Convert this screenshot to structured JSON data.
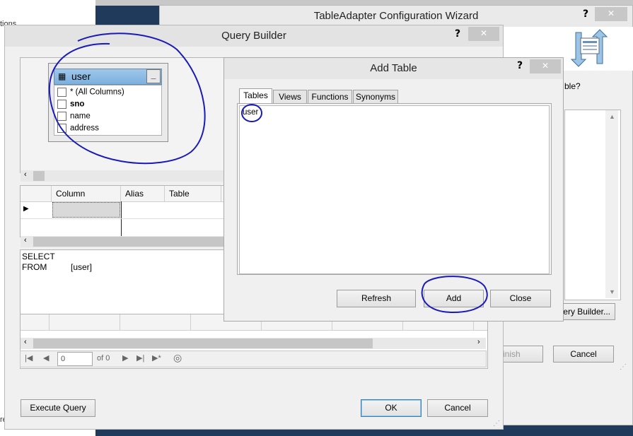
{
  "background": {
    "left_top_text": "tions",
    "left_bottom_text": "re"
  },
  "wizard": {
    "title": "TableAdapter Configuration Wizard",
    "help_glyph": "?",
    "close_glyph": "✕",
    "question_partial": "ble?",
    "query_builder_button": "ery Builder...",
    "finish_button": "inish",
    "cancel_button": "Cancel"
  },
  "query_builder": {
    "title": "Query Builder",
    "help_glyph": "?",
    "close_glyph": "✕",
    "table_box": {
      "title": "user",
      "minimize_glyph": "_",
      "columns": [
        {
          "label": "* (All Columns)",
          "bold": false
        },
        {
          "label": "sno",
          "bold": true
        },
        {
          "label": "name",
          "bold": false
        },
        {
          "label": "address",
          "bold": false
        }
      ]
    },
    "grid_headers": [
      "Column",
      "Alias",
      "Table"
    ],
    "row_arrow": "▶",
    "sql": {
      "line1": "SELECT",
      "line2_keyword": "FROM",
      "line2_value": "[user]"
    },
    "navigator": {
      "position_value": "0",
      "of_label": "of 0"
    },
    "execute_button": "Execute Query",
    "ok_button": "OK",
    "cancel_button": "Cancel"
  },
  "add_table": {
    "title": "Add Table",
    "help_glyph": "?",
    "close_glyph": "✕",
    "tabs": [
      "Tables",
      "Views",
      "Functions",
      "Synonyms"
    ],
    "active_tab": "Tables",
    "items": [
      "user"
    ],
    "refresh_button": "Refresh",
    "add_button": "Add",
    "close_button": "Close"
  },
  "colors": {
    "annotation": "#1a1ab8"
  }
}
